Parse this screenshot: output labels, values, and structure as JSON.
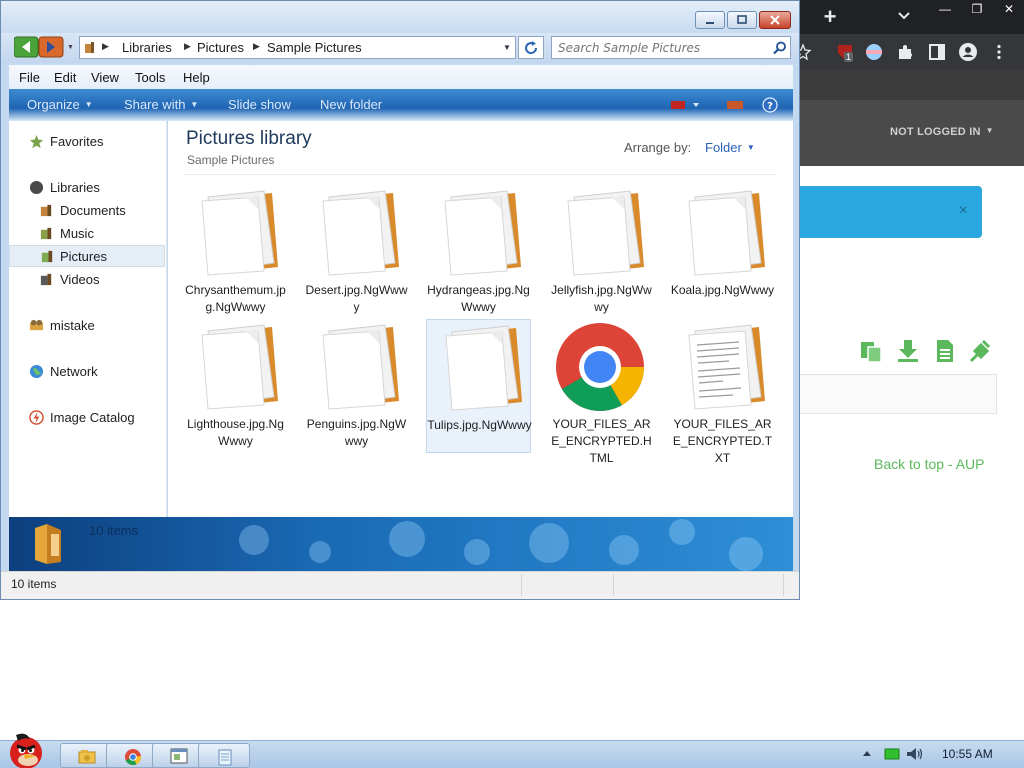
{
  "explorer": {
    "breadcrumb": [
      "Libraries",
      "Pictures",
      "Sample Pictures"
    ],
    "search_placeholder": "Search Sample Pictures",
    "menus": [
      "File",
      "Edit",
      "View",
      "Tools",
      "Help"
    ],
    "commands": {
      "organize": "Organize",
      "share_with": "Share with",
      "slide_show": "Slide show",
      "new_folder": "New folder"
    },
    "nav": {
      "favorites": "Favorites",
      "libraries": "Libraries",
      "documents": "Documents",
      "music": "Music",
      "pictures": "Pictures",
      "videos": "Videos",
      "mistake": "mistake",
      "network": "Network",
      "image_catalog": "Image Catalog"
    },
    "library_title": "Pictures library",
    "library_subtitle": "Sample Pictures",
    "arrange_label": "Arrange by:",
    "arrange_value": "Folder",
    "files": [
      {
        "name": "Chrysanthemum.jpg.NgWwwy",
        "icon": "blank-file-icon"
      },
      {
        "name": "Desert.jpg.NgWwwy",
        "icon": "blank-file-icon"
      },
      {
        "name": "Hydrangeas.jpg.NgWwwy",
        "icon": "blank-file-icon"
      },
      {
        "name": "Jellyfish.jpg.NgWwwy",
        "icon": "blank-file-icon"
      },
      {
        "name": "Koala.jpg.NgWwwy",
        "icon": "blank-file-icon"
      },
      {
        "name": "Lighthouse.jpg.NgWwwy",
        "icon": "blank-file-icon"
      },
      {
        "name": "Penguins.jpg.NgWwwy",
        "icon": "blank-file-icon"
      },
      {
        "name": "Tulips.jpg.NgWwwy",
        "icon": "blank-file-icon"
      },
      {
        "name": "YOUR_FILES_ARE_ENCRYPTED.HTML",
        "icon": "chrome-icon"
      },
      {
        "name": "YOUR_FILES_ARE_ENCRYPTED.TXT",
        "icon": "text-document-icon"
      }
    ],
    "details_count": "10 items",
    "status_count": "10 items"
  },
  "browser": {
    "not_logged_in": "NOT LOGGED IN",
    "footer_back": "Back to top",
    "footer_sep": " - ",
    "footer_aup": "AUP",
    "extension_badge": "1",
    "alert_close": "×"
  },
  "taskbar": {
    "clock": "10:55 AM"
  },
  "colors": {
    "library_title": "#1e395b",
    "link_blue": "#2a62b8",
    "footer_green": "#5cb85c",
    "alert_blue": "#29a8e0",
    "browser_dark": "#202124"
  }
}
